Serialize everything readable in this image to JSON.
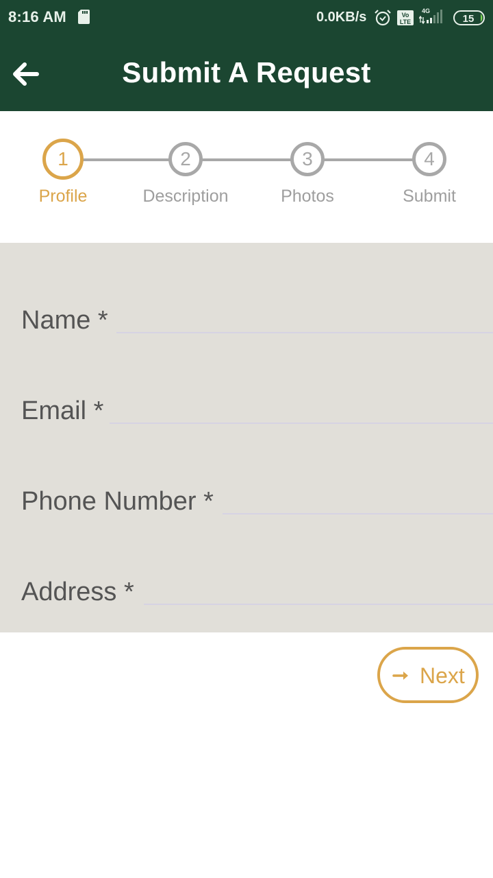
{
  "status_bar": {
    "time": "8:16 AM",
    "network_speed": "0.0KB/s",
    "network_type": "4G",
    "volte_label_top": "Vo",
    "volte_label_bottom": "LTE",
    "battery_level": "15",
    "icons": [
      "sd-card-icon",
      "alarm-icon",
      "volte-icon",
      "signal-icon",
      "battery-icon"
    ]
  },
  "app_bar": {
    "title": "Submit A Request",
    "back_icon": "arrow-left-icon"
  },
  "stepper": {
    "current_step": 1,
    "steps": [
      {
        "number": "1",
        "label": "Profile",
        "active": true
      },
      {
        "number": "2",
        "label": "Description",
        "active": false
      },
      {
        "number": "3",
        "label": "Photos",
        "active": false
      },
      {
        "number": "4",
        "label": "Submit",
        "active": false
      }
    ]
  },
  "form": {
    "fields": [
      {
        "label": "Name *",
        "value": ""
      },
      {
        "label": "Email *",
        "value": ""
      },
      {
        "label": "Phone Number *",
        "value": ""
      },
      {
        "label": "Address *",
        "value": ""
      }
    ]
  },
  "actions": {
    "next_label": "Next",
    "next_icon": "arrow-right-icon"
  },
  "colors": {
    "primary": "#1b4631",
    "accent": "#dba54a",
    "inactive": "#a8a8a8",
    "form_background": "#e1dfd9"
  }
}
